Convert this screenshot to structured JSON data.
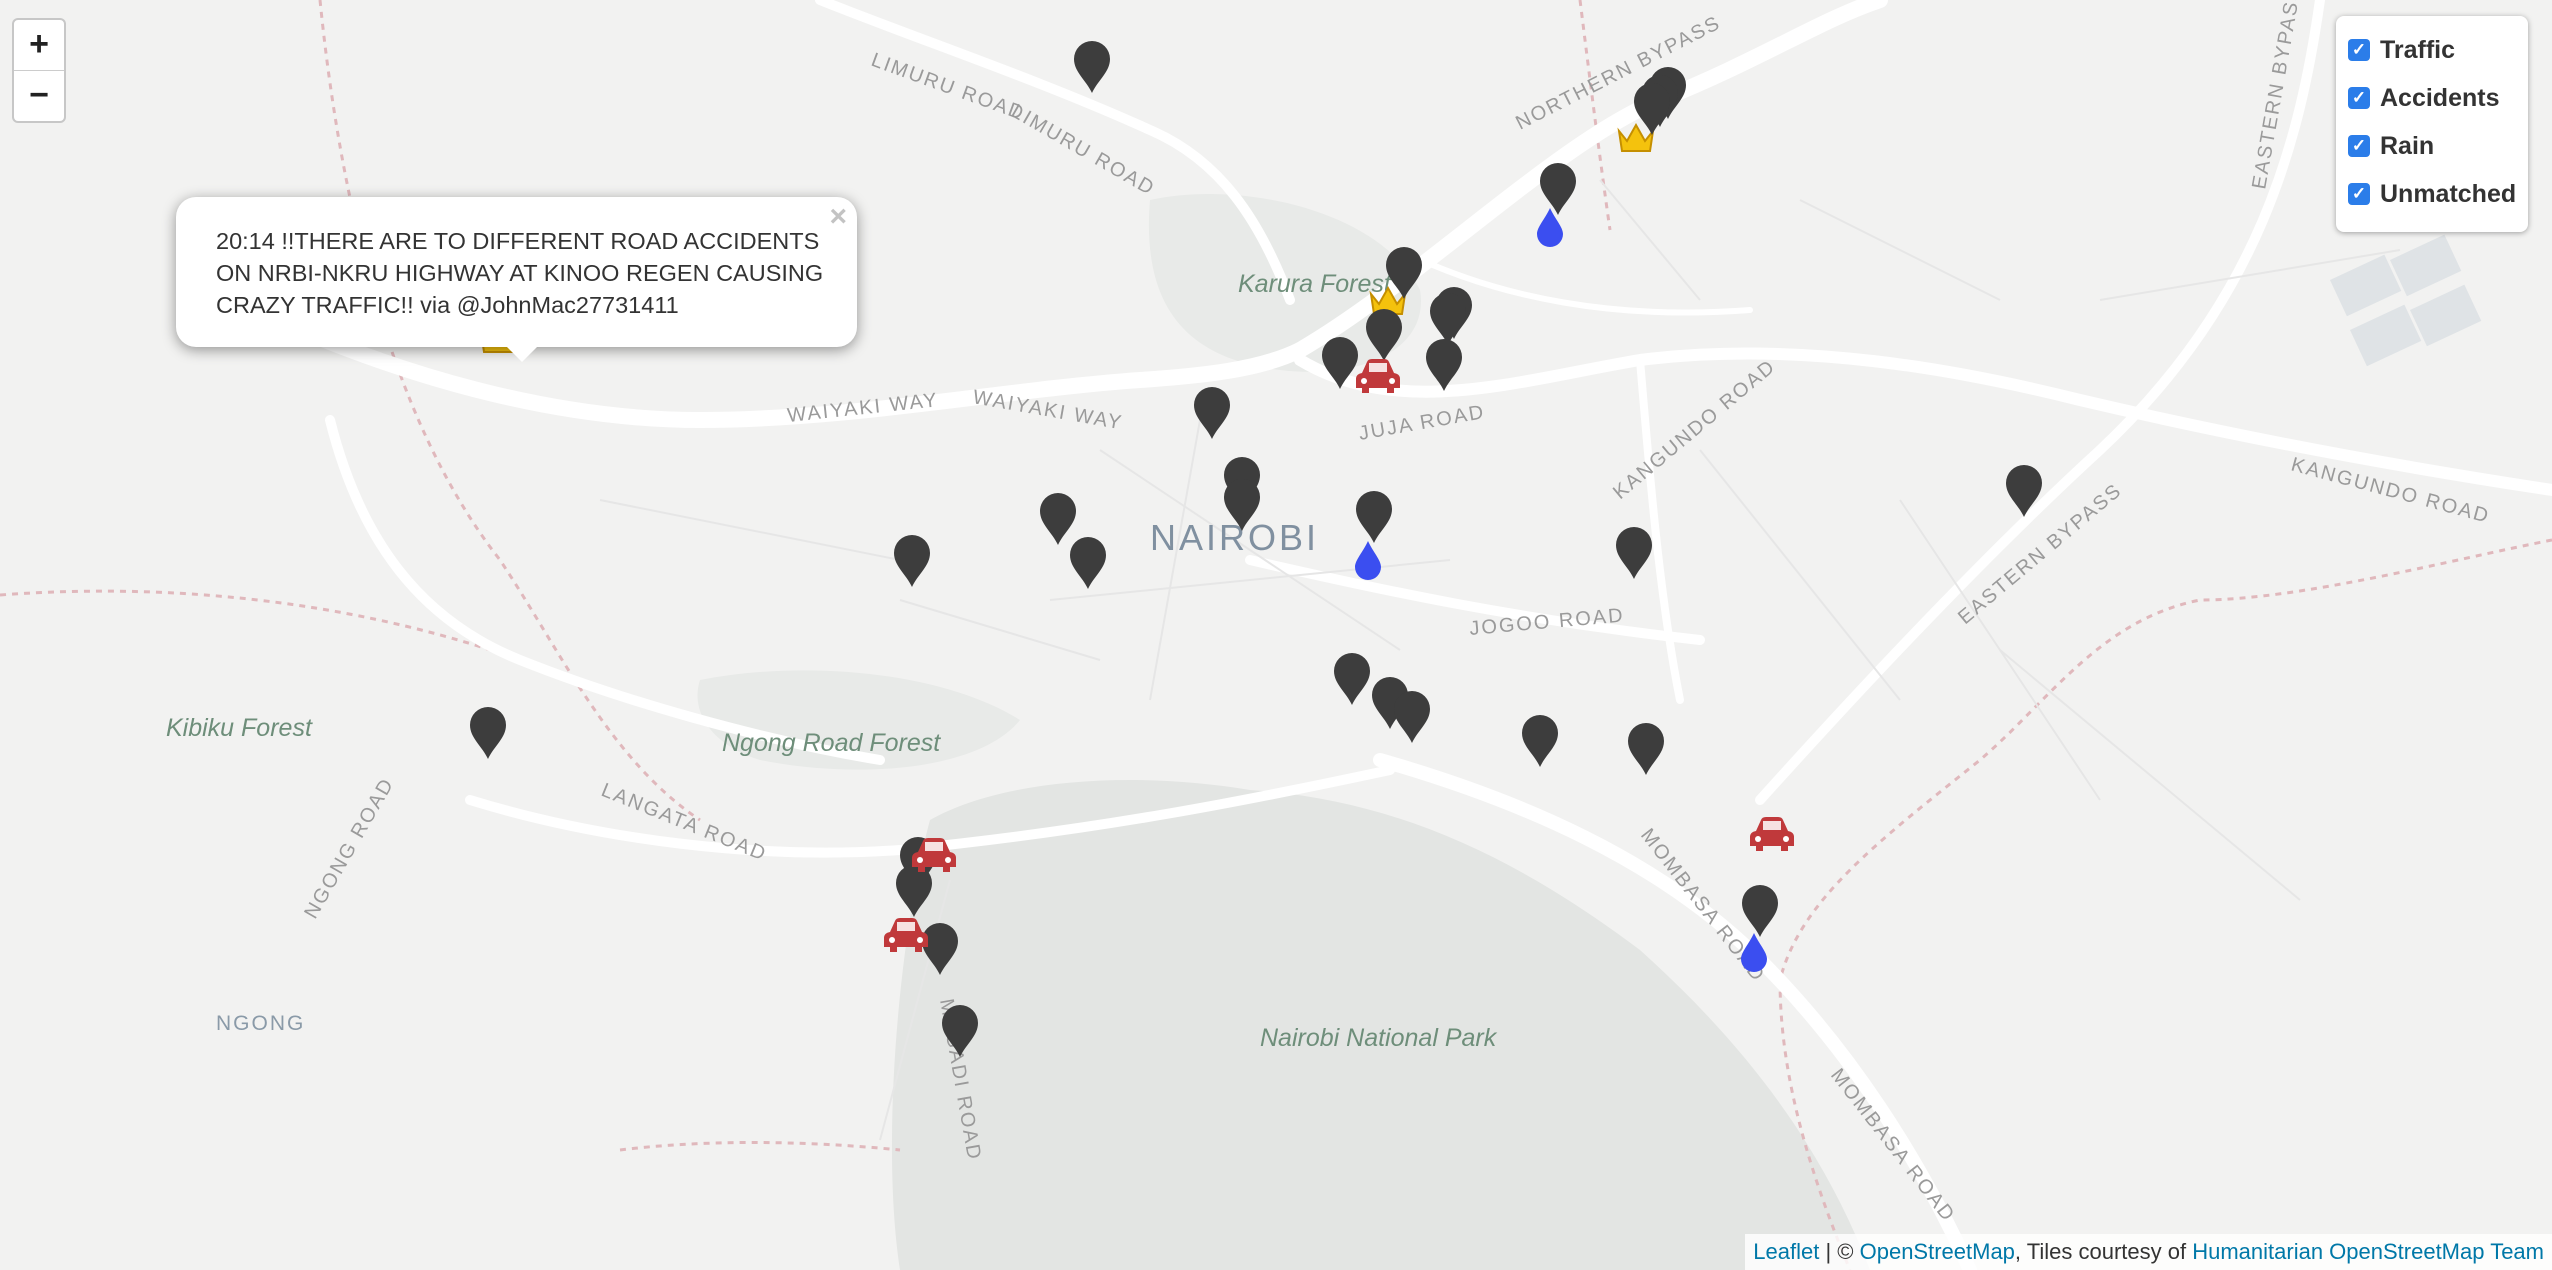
{
  "zoom": {
    "in_label": "+",
    "out_label": "−"
  },
  "layers": [
    {
      "label": "Traffic",
      "checked": true
    },
    {
      "label": "Accidents",
      "checked": true
    },
    {
      "label": "Rain",
      "checked": true
    },
    {
      "label": "Unmatched",
      "checked": true
    }
  ],
  "popup": {
    "text": "20:14 !!THERE ARE TO DIFFERENT ROAD ACCIDENTS ON NRBI-NKRU HIGHWAY AT KINOO REGEN CAUSING CRAZY TRAFFIC!! via @JohnMac27731411",
    "close_label": "×"
  },
  "attribution": {
    "leaflet": "Leaflet",
    "sep1": " | © ",
    "osm": "OpenStreetMap",
    "sep2": ", Tiles courtesy of ",
    "hot": "Humanitarian OpenStreetMap Team"
  },
  "map_labels": [
    "LIMURU ROAD",
    "LIMURU ROAD",
    "NORTHERN BYPASS",
    "EASTERN BYPASS",
    "Karura Forest",
    "WAIYAKI WAY",
    "WAIYAKI WAY",
    "JUJA ROAD",
    "KANGUNDO ROAD",
    "KANGUNDO ROAD",
    "NAIROBI",
    "EASTERN BYPASS",
    "JOGOO ROAD",
    "Kibiku Forest",
    "Ngong Road Forest",
    "LANGATA ROAD",
    "NGONG ROAD",
    "MOMBASA ROAD",
    "NGONG",
    "MAGADI ROAD",
    "Nairobi National Park",
    "MOMBASA ROAD"
  ],
  "colors": {
    "unmatched": "#3d3d3d",
    "accident": "#c0393b",
    "rain": "#3b4ef0",
    "traffic": "#f4c20d",
    "park": "#e3e5e3",
    "road": "#ffffff"
  }
}
